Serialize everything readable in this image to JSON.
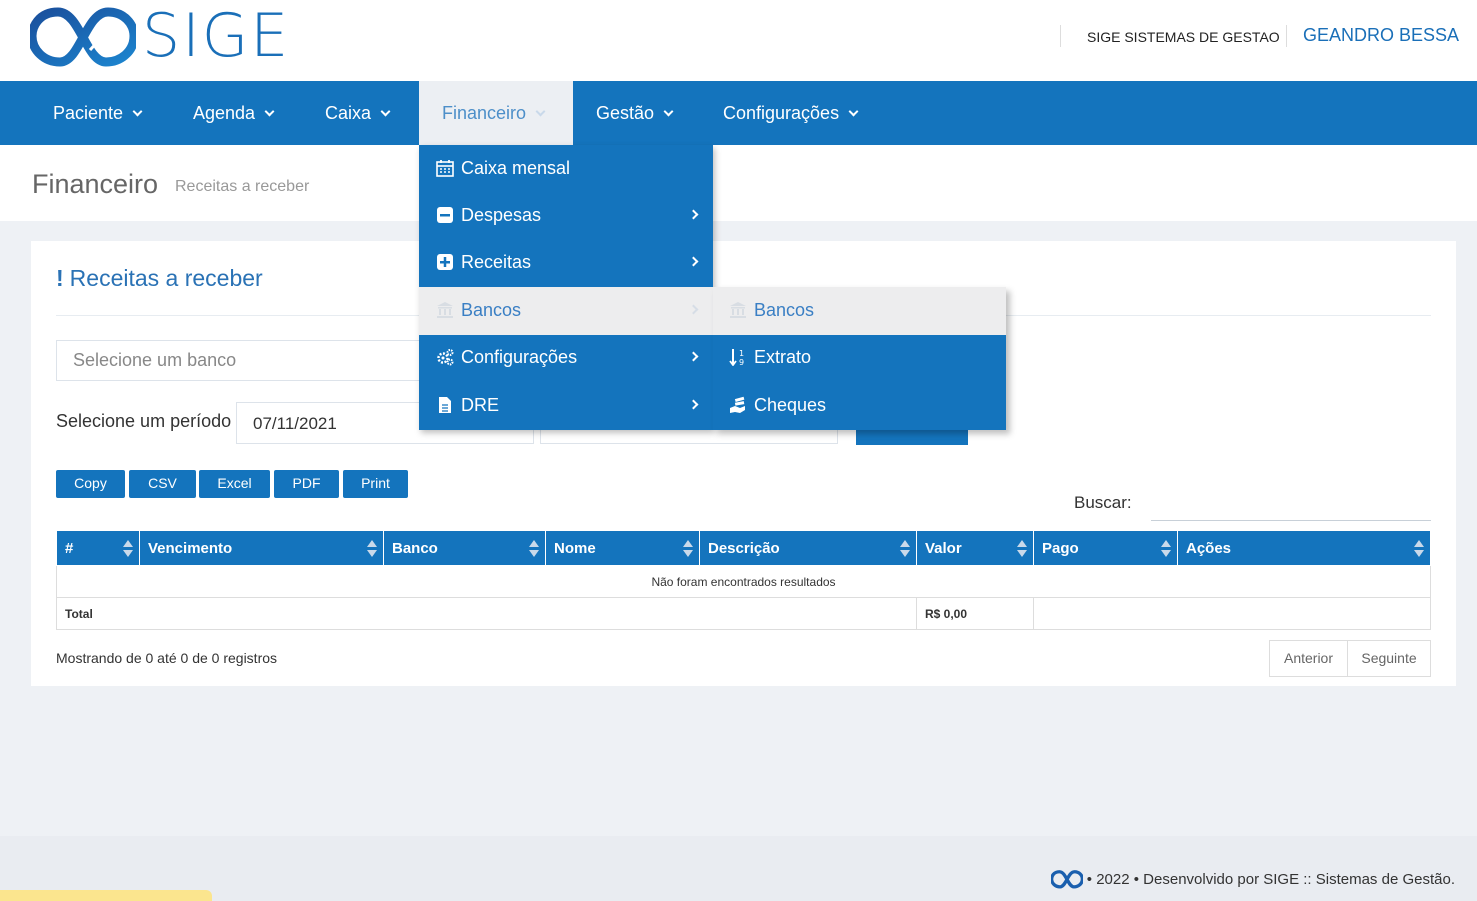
{
  "header": {
    "logo_text": "SIGE",
    "company": "SIGE SISTEMAS DE GESTAO",
    "user": "GEANDRO BESSA"
  },
  "nav": {
    "items": [
      {
        "label": "Paciente"
      },
      {
        "label": "Agenda"
      },
      {
        "label": "Caixa"
      },
      {
        "label": "Financeiro"
      },
      {
        "label": "Gestão"
      },
      {
        "label": "Configurações"
      }
    ],
    "active": "Financeiro"
  },
  "page": {
    "title": "Financeiro",
    "subtitle": "Receitas a receber"
  },
  "panel": {
    "title": "Receitas a receber",
    "bank_placeholder": "Selecione um banco",
    "period_label": "Selecione um período",
    "date_start": "07/11/2021"
  },
  "export_buttons": [
    "Copy",
    "CSV",
    "Excel",
    "PDF",
    "Print"
  ],
  "search": {
    "label": "Buscar:"
  },
  "table": {
    "columns": [
      "#",
      "Vencimento",
      "Banco",
      "Nome",
      "Descrição",
      "Valor",
      "Pago",
      "Ações"
    ],
    "empty_message": "Não foram encontrados resultados",
    "total_label": "Total",
    "total_value": "R$ 0,00"
  },
  "pagination": {
    "info": "Mostrando de 0 até 0 de 0 registros",
    "prev": "Anterior",
    "next": "Seguinte"
  },
  "dropdown": {
    "items": [
      {
        "label": "Caixa mensal",
        "icon": "calendar-icon",
        "has_submenu": false
      },
      {
        "label": "Despesas",
        "icon": "minus-square-icon",
        "has_submenu": true
      },
      {
        "label": "Receitas",
        "icon": "plus-square-icon",
        "has_submenu": true
      },
      {
        "label": "Bancos",
        "icon": "bank-icon",
        "has_submenu": true,
        "active": true
      },
      {
        "label": "Configurações",
        "icon": "cogs-icon",
        "has_submenu": true
      },
      {
        "label": "DRE",
        "icon": "file-icon",
        "has_submenu": true
      }
    ],
    "submenu": [
      {
        "label": "Bancos",
        "icon": "bank-icon",
        "active": true
      },
      {
        "label": "Extrato",
        "icon": "sort-numeric-icon"
      },
      {
        "label": "Cheques",
        "icon": "money-hand-icon"
      }
    ]
  },
  "footer": {
    "text": "• 2022 • Desenvolvido por SIGE :: Sistemas de Gestão."
  },
  "colors": {
    "primary": "#1474bd",
    "active_nav_bg": "#eceff3",
    "page_bg": "#eef1f5"
  }
}
